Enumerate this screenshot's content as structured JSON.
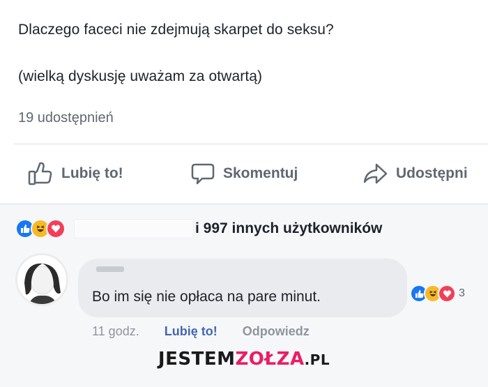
{
  "post": {
    "line1": "Dlaczego faceci nie zdejmują skarpet do seksu?",
    "line2": "(wielką dyskusję uważam za otwartą)",
    "shares": "19 udostępnień"
  },
  "actions": {
    "like": "Lubię to!",
    "comment": "Skomentuj",
    "share": "Udostępni"
  },
  "reactions": {
    "icons": [
      "like-icon",
      "haha-icon",
      "love-icon"
    ],
    "summary": "i 997 innych użytkowników"
  },
  "comment": {
    "text": "Bo im się nie opłaca na pare minut.",
    "reactions_count": "3",
    "time": "11 godz.",
    "like_label": "Lubię to!",
    "reply_label": "Odpowiedz"
  },
  "watermark": {
    "part1": "JESTEM",
    "part2": "ZOŁZA",
    "part3": ".PL"
  },
  "colors": {
    "like": "#1877f2",
    "haha": "#f7b928",
    "love": "#f33e58",
    "link": "#4267b2",
    "watermark_accent": "#e91e63"
  }
}
